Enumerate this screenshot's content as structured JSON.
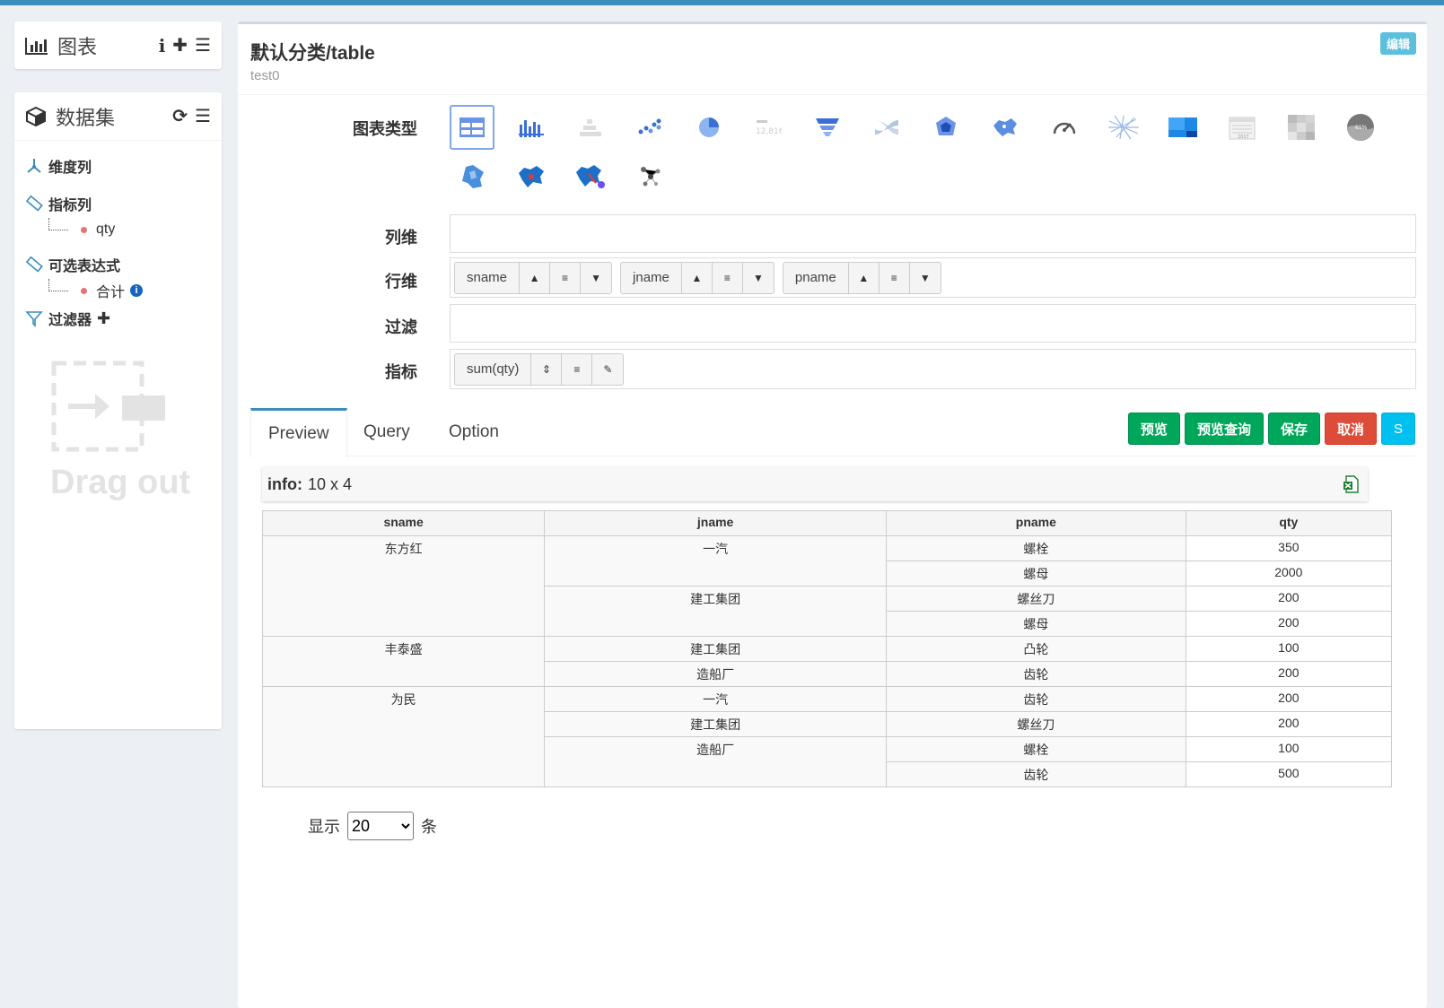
{
  "chart_panel": {
    "title": "图表"
  },
  "dataset_panel": {
    "title": "数据集",
    "dimensions_label": "维度列",
    "measures_label": "指标列",
    "measures": [
      "qty"
    ],
    "expressions_label": "可选表达式",
    "expressions": [
      "合计"
    ],
    "filters_label": "过滤器",
    "drag_out": "Drag out"
  },
  "main": {
    "title": "默认分类/table",
    "subtitle": "test0",
    "edit_badge": "编辑",
    "chart_type_label": "图表类型",
    "chart_types": [
      "table",
      "bar",
      "funnel-bar",
      "scatter",
      "pie",
      "kpi",
      "funnel",
      "sankey",
      "radar",
      "map",
      "gauge",
      "wordcloud",
      "treemap",
      "calendar",
      "heatmap",
      "liquid",
      "map-province",
      "map-bubble",
      "map-marker",
      "relation"
    ],
    "col_dim_label": "列维",
    "row_dim_label": "行维",
    "row_dims": [
      "sname",
      "jname",
      "pname"
    ],
    "filter_label": "过滤",
    "measure_label": "指标",
    "measure_items": [
      "sum(qty)"
    ],
    "tabs": [
      "Preview",
      "Query",
      "Option"
    ],
    "buttons": {
      "preview": "预览",
      "preview_query": "预览查询",
      "save": "保存",
      "cancel": "取消",
      "s": "S"
    },
    "info_label": "info:",
    "info_value": "10 x 4",
    "table": {
      "headers": [
        "sname",
        "jname",
        "pname",
        "qty"
      ],
      "rows": [
        [
          "东方红",
          "一汽",
          "螺栓",
          "350"
        ],
        [
          "",
          "",
          "螺母",
          "2000"
        ],
        [
          "",
          "建工集团",
          "螺丝刀",
          "200"
        ],
        [
          "",
          "",
          "螺母",
          "200"
        ],
        [
          "丰泰盛",
          "建工集团",
          "凸轮",
          "100"
        ],
        [
          "",
          "造船厂",
          "齿轮",
          "200"
        ],
        [
          "为民",
          "一汽",
          "齿轮",
          "200"
        ],
        [
          "",
          "建工集团",
          "螺丝刀",
          "200"
        ],
        [
          "",
          "造船厂",
          "螺栓",
          "100"
        ],
        [
          "",
          "",
          "齿轮",
          "500"
        ]
      ]
    },
    "pager": {
      "prefix": "显示",
      "value": "20",
      "suffix": "条"
    }
  }
}
